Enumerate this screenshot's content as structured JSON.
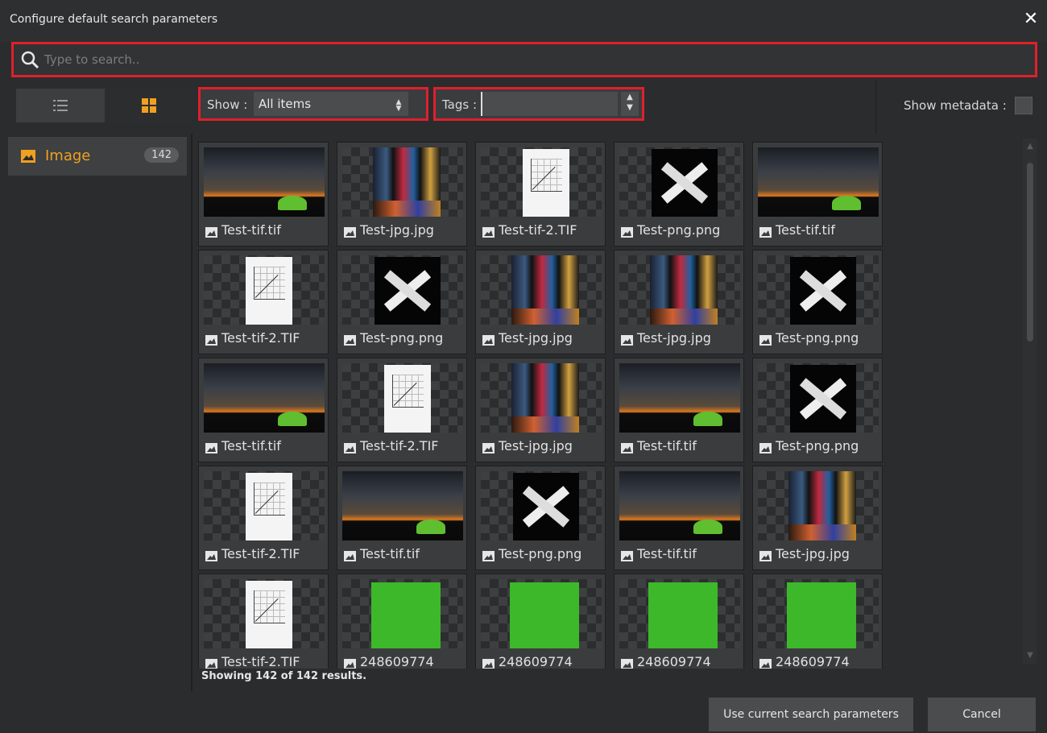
{
  "dialog": {
    "title": "Configure default search parameters"
  },
  "search": {
    "placeholder": "Type to search..",
    "value": ""
  },
  "toolbar": {
    "show_label": "Show :",
    "show_value": "All items",
    "tags_label": "Tags :",
    "tags_value": "",
    "metadata_label": "Show metadata :",
    "view_mode": "grid"
  },
  "sidebar": {
    "items": [
      {
        "label": "Image",
        "count": "142",
        "icon": "image-icon",
        "color": "#f0a020"
      }
    ]
  },
  "grid": {
    "columns": 5,
    "items": [
      {
        "label": "Test-tif.tif",
        "thumb": "night"
      },
      {
        "label": "Test-jpg.jpg",
        "thumb": "city"
      },
      {
        "label": "Test-tif-2.TIF",
        "thumb": "paper"
      },
      {
        "label": "Test-png.png",
        "thumb": "sign"
      },
      {
        "label": "Test-tif.tif",
        "thumb": "night"
      },
      {
        "label": "Test-tif-2.TIF",
        "thumb": "paper"
      },
      {
        "label": "Test-png.png",
        "thumb": "sign"
      },
      {
        "label": "Test-jpg.jpg",
        "thumb": "city"
      },
      {
        "label": "Test-jpg.jpg",
        "thumb": "city"
      },
      {
        "label": "Test-png.png",
        "thumb": "sign"
      },
      {
        "label": "Test-tif.tif",
        "thumb": "night"
      },
      {
        "label": "Test-tif-2.TIF",
        "thumb": "paper"
      },
      {
        "label": "Test-jpg.jpg",
        "thumb": "city"
      },
      {
        "label": "Test-tif.tif",
        "thumb": "night"
      },
      {
        "label": "Test-png.png",
        "thumb": "sign"
      },
      {
        "label": "Test-tif-2.TIF",
        "thumb": "paper"
      },
      {
        "label": "Test-tif.tif",
        "thumb": "night"
      },
      {
        "label": "Test-png.png",
        "thumb": "sign"
      },
      {
        "label": "Test-tif.tif",
        "thumb": "night"
      },
      {
        "label": "Test-jpg.jpg",
        "thumb": "city"
      },
      {
        "label": "Test-tif-2.TIF",
        "thumb": "paper"
      },
      {
        "label": "248609774",
        "thumb": "green"
      },
      {
        "label": "248609774",
        "thumb": "green"
      },
      {
        "label": "248609774",
        "thumb": "green"
      },
      {
        "label": "248609774",
        "thumb": "green"
      }
    ]
  },
  "status": {
    "text": "Showing 142 of 142 results."
  },
  "footer": {
    "use_label": "Use current search parameters",
    "cancel_label": "Cancel"
  },
  "colors": {
    "accent": "#f0a020",
    "highlight_border": "#e0202a",
    "background": "#2a2c2e"
  }
}
